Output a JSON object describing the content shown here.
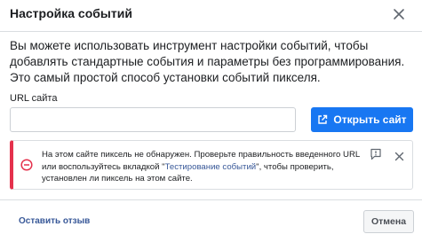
{
  "dialog": {
    "title": "Настройка событий",
    "close_icon": "close-icon",
    "description": "Вы можете использовать инструмент настройки событий, чтобы добавлять стандартные события и параметры без программирования. Это самый простой способ установки событий пикселя."
  },
  "url": {
    "label": "URL сайта",
    "value": "",
    "placeholder": ""
  },
  "open_button": {
    "label": "Открыть сайт",
    "icon": "external-link-icon"
  },
  "alert": {
    "icon": "error-circle-icon",
    "text_before": "На этом сайте пиксель не обнаружен. Проверьте правильность введенного URL или воспользуйтесь вкладкой \"",
    "link_text": "Тестирование событий",
    "text_after": "\", чтобы проверить, установлен ли пиксель на этом сайте.",
    "report_icon": "report-icon",
    "close_icon": "close-icon",
    "accent_color": "#e4314c"
  },
  "footer": {
    "feedback_label": "Оставить отзыв",
    "cancel_label": "Отмена"
  },
  "colors": {
    "primary": "#1877f2",
    "link": "#385898",
    "error": "#e4314c"
  }
}
